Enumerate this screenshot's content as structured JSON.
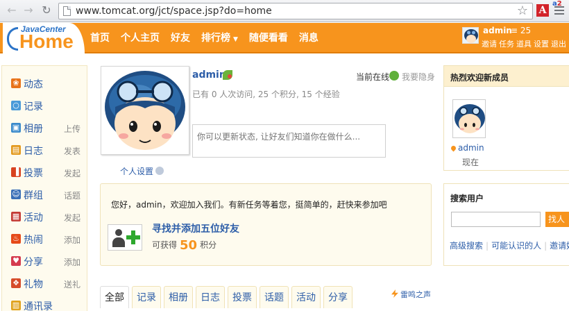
{
  "browser": {
    "url": "www.tomcat.org/jct/space.jsp?do=home",
    "back_icon": "back-arrow-icon",
    "forward_icon": "forward-arrow-icon",
    "reload_icon": "reload-icon",
    "star_icon": "star-icon",
    "ext_letter": "A",
    "ext2_text": "a",
    "ext2_red": "2"
  },
  "header": {
    "logo_sub": "JavaCenter",
    "logo_main": "Home",
    "nav": [
      {
        "label": "首页"
      },
      {
        "label": "个人主页"
      },
      {
        "label": "好友"
      },
      {
        "label": "排行榜",
        "caret": "▼"
      },
      {
        "label": "随便看看"
      },
      {
        "label": "消息"
      }
    ],
    "user": {
      "name": "admin",
      "credit": "25",
      "credit_icon": "coin-icon",
      "links": [
        "邀请",
        "任务",
        "道具",
        "设置",
        "退出"
      ]
    }
  },
  "sidebar": {
    "items": [
      {
        "label": "动态",
        "action": "",
        "icon": "paw-icon",
        "color": "#e8731a"
      },
      {
        "label": "记录",
        "action": "",
        "icon": "speech-bubble-icon",
        "color": "#4a9ad8"
      },
      {
        "label": "相册",
        "action": "上传",
        "icon": "photo-icon",
        "color": "#3a8acb"
      },
      {
        "label": "日志",
        "action": "发表",
        "icon": "notebook-icon",
        "color": "#e39a1f"
      },
      {
        "label": "投票",
        "action": "发起",
        "icon": "bar-chart-icon",
        "color": "#d8421f"
      },
      {
        "label": "群组",
        "action": "话题",
        "icon": "group-icon",
        "color": "#3b6fb7"
      },
      {
        "label": "活动",
        "action": "发起",
        "icon": "calendar-icon",
        "color": "#c43b36"
      },
      {
        "label": "热闹",
        "action": "添加",
        "icon": "fire-icon",
        "color": "#e64a19"
      },
      {
        "label": "分享",
        "action": "添加",
        "icon": "heart-icon",
        "color": "#d53b4e"
      },
      {
        "label": "礼物",
        "action": "送礼",
        "icon": "gift-icon",
        "color": "#d64c2a"
      },
      {
        "label": "通讯录",
        "action": "",
        "icon": "contacts-icon",
        "color": "#e0a21d"
      }
    ]
  },
  "profile": {
    "name": "admin",
    "online_label": "当前在线",
    "hide_label": "我要隐身",
    "stats": "已有 0 人次访问, 25 个积分, 15 个经验",
    "settings_label": "个人设置",
    "status_placeholder": "你可以更新状态, 让好友们知道你在做什么..."
  },
  "welcome": {
    "text": "您好，admin，欢迎加入我们。有新任务等着您，挺简单的，赶快来参加吧",
    "task_title": "寻找并添加五位好友",
    "reward_prefix": "可获得",
    "reward_value": "50",
    "reward_suffix": "积分"
  },
  "tabs": [
    {
      "label": "全部",
      "active": true
    },
    {
      "label": "记录"
    },
    {
      "label": "相册"
    },
    {
      "label": "日志"
    },
    {
      "label": "投票"
    },
    {
      "label": "话题"
    },
    {
      "label": "活动"
    },
    {
      "label": "分享"
    }
  ],
  "thunder_label": "雷鸣之声",
  "new_members": {
    "title": "热烈欢迎新成员",
    "member_name": "admin",
    "member_time": "现在"
  },
  "search_users": {
    "title": "搜索用户",
    "button": "找人",
    "links": [
      "高级搜索",
      "可能认识的人",
      "邀请好"
    ]
  }
}
